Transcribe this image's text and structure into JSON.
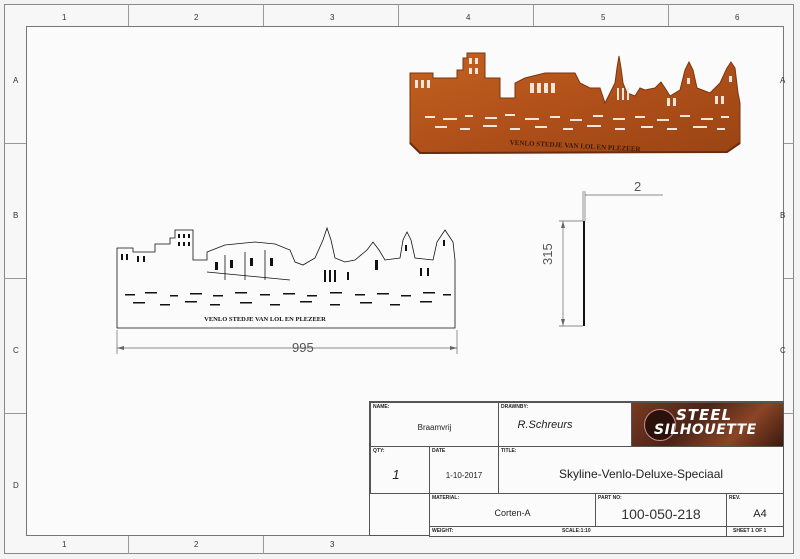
{
  "border": {
    "columns": [
      "1",
      "2",
      "3",
      "4",
      "5",
      "6"
    ],
    "rows": [
      "A",
      "B",
      "C",
      "D"
    ]
  },
  "drawing": {
    "engraving_text": "VENLO STEDJE VAN LOL EN PLEZEER",
    "dim_width": "995",
    "dim_height": "315",
    "dim_thickness": "2"
  },
  "title_block": {
    "name_label": "NAME:",
    "name_value": "Braamvrij",
    "drawer_label": "DRAWNBY:",
    "drawer_value": "R.Schreurs",
    "qty_label": "QTY:",
    "qty_value": "1",
    "date_label": "DATE",
    "date_value": "1-10-2017",
    "title_label": "TITLE:",
    "title_value": "Skyline-Venlo-Deluxe-Speciaal",
    "material_label": "MATERIAL:",
    "material_value": "Corten-A",
    "partno_label": "PART NO:",
    "partno_value": "100-050-218",
    "rev_label": "REV.",
    "size_value": "A4",
    "weight_label": "WEIGHT:",
    "scale_label": "SCALE:1:10",
    "sheet_label": "SHEET 1 OF 1"
  },
  "logo": {
    "line1": "STEEL",
    "line2": "SILHOUETTE"
  },
  "colors": {
    "corten": "#b5541c",
    "corten_dark": "#8a3a10",
    "line": "#111111"
  }
}
